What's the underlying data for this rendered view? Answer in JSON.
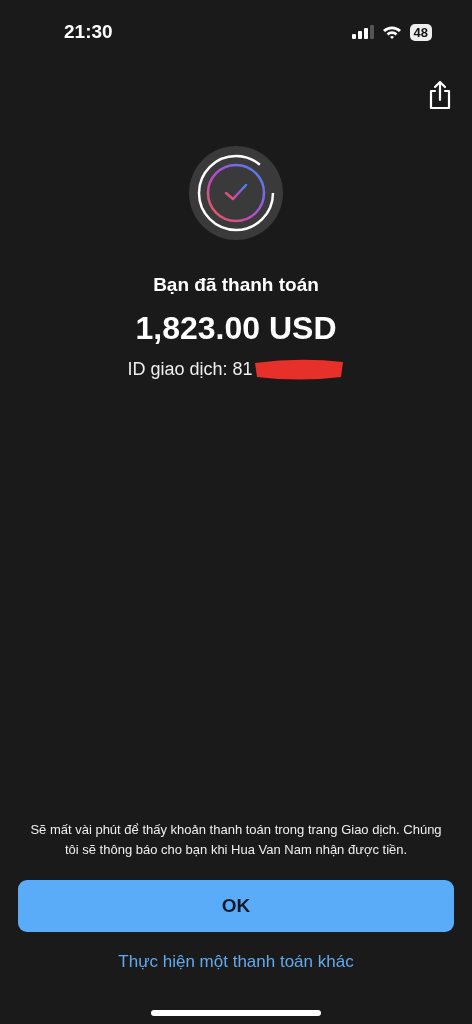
{
  "status_bar": {
    "time": "21:30",
    "battery": "48"
  },
  "payment": {
    "title": "Bạn đã thanh toán",
    "amount": "1,823.00 USD",
    "transaction_id": "ID giao dịch: 81",
    "id_redacted": true
  },
  "notice": "Sẽ mất vài phút để thấy khoản thanh toán trong trang Giao dịch. Chúng tôi sẽ thông báo cho bạn khi Hua Van Nam nhận được tiền.",
  "buttons": {
    "primary": "OK",
    "link": "Thực hiện một thanh toán khác"
  }
}
